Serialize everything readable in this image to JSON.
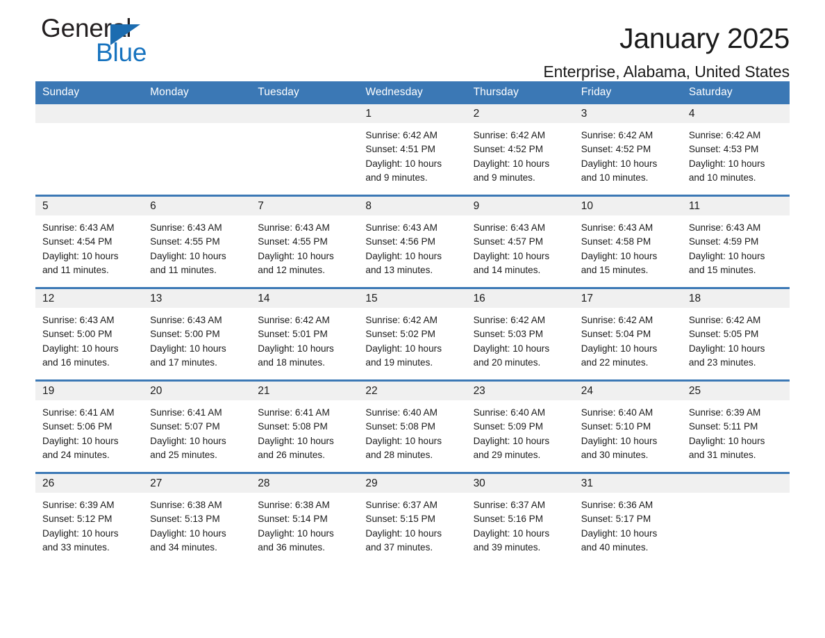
{
  "brand": {
    "word1": "General",
    "word2": "Blue",
    "accent_color": "#1b6cb0"
  },
  "header": {
    "title": "January 2025",
    "location": "Enterprise, Alabama, United States"
  },
  "theme": {
    "header_blue": "#3b78b5",
    "daynum_gray": "#f0f0f0",
    "text": "#1a1a1a"
  },
  "weekdays": [
    "Sunday",
    "Monday",
    "Tuesday",
    "Wednesday",
    "Thursday",
    "Friday",
    "Saturday"
  ],
  "weeks": [
    [
      {
        "day": "",
        "sunrise": "",
        "sunset": "",
        "daylight1": "",
        "daylight2": "",
        "empty": true
      },
      {
        "day": "",
        "sunrise": "",
        "sunset": "",
        "daylight1": "",
        "daylight2": "",
        "empty": true
      },
      {
        "day": "",
        "sunrise": "",
        "sunset": "",
        "daylight1": "",
        "daylight2": "",
        "empty": true
      },
      {
        "day": "1",
        "sunrise": "Sunrise: 6:42 AM",
        "sunset": "Sunset: 4:51 PM",
        "daylight1": "Daylight: 10 hours",
        "daylight2": "and 9 minutes."
      },
      {
        "day": "2",
        "sunrise": "Sunrise: 6:42 AM",
        "sunset": "Sunset: 4:52 PM",
        "daylight1": "Daylight: 10 hours",
        "daylight2": "and 9 minutes."
      },
      {
        "day": "3",
        "sunrise": "Sunrise: 6:42 AM",
        "sunset": "Sunset: 4:52 PM",
        "daylight1": "Daylight: 10 hours",
        "daylight2": "and 10 minutes."
      },
      {
        "day": "4",
        "sunrise": "Sunrise: 6:42 AM",
        "sunset": "Sunset: 4:53 PM",
        "daylight1": "Daylight: 10 hours",
        "daylight2": "and 10 minutes."
      }
    ],
    [
      {
        "day": "5",
        "sunrise": "Sunrise: 6:43 AM",
        "sunset": "Sunset: 4:54 PM",
        "daylight1": "Daylight: 10 hours",
        "daylight2": "and 11 minutes."
      },
      {
        "day": "6",
        "sunrise": "Sunrise: 6:43 AM",
        "sunset": "Sunset: 4:55 PM",
        "daylight1": "Daylight: 10 hours",
        "daylight2": "and 11 minutes."
      },
      {
        "day": "7",
        "sunrise": "Sunrise: 6:43 AM",
        "sunset": "Sunset: 4:55 PM",
        "daylight1": "Daylight: 10 hours",
        "daylight2": "and 12 minutes."
      },
      {
        "day": "8",
        "sunrise": "Sunrise: 6:43 AM",
        "sunset": "Sunset: 4:56 PM",
        "daylight1": "Daylight: 10 hours",
        "daylight2": "and 13 minutes."
      },
      {
        "day": "9",
        "sunrise": "Sunrise: 6:43 AM",
        "sunset": "Sunset: 4:57 PM",
        "daylight1": "Daylight: 10 hours",
        "daylight2": "and 14 minutes."
      },
      {
        "day": "10",
        "sunrise": "Sunrise: 6:43 AM",
        "sunset": "Sunset: 4:58 PM",
        "daylight1": "Daylight: 10 hours",
        "daylight2": "and 15 minutes."
      },
      {
        "day": "11",
        "sunrise": "Sunrise: 6:43 AM",
        "sunset": "Sunset: 4:59 PM",
        "daylight1": "Daylight: 10 hours",
        "daylight2": "and 15 minutes."
      }
    ],
    [
      {
        "day": "12",
        "sunrise": "Sunrise: 6:43 AM",
        "sunset": "Sunset: 5:00 PM",
        "daylight1": "Daylight: 10 hours",
        "daylight2": "and 16 minutes."
      },
      {
        "day": "13",
        "sunrise": "Sunrise: 6:43 AM",
        "sunset": "Sunset: 5:00 PM",
        "daylight1": "Daylight: 10 hours",
        "daylight2": "and 17 minutes."
      },
      {
        "day": "14",
        "sunrise": "Sunrise: 6:42 AM",
        "sunset": "Sunset: 5:01 PM",
        "daylight1": "Daylight: 10 hours",
        "daylight2": "and 18 minutes."
      },
      {
        "day": "15",
        "sunrise": "Sunrise: 6:42 AM",
        "sunset": "Sunset: 5:02 PM",
        "daylight1": "Daylight: 10 hours",
        "daylight2": "and 19 minutes."
      },
      {
        "day": "16",
        "sunrise": "Sunrise: 6:42 AM",
        "sunset": "Sunset: 5:03 PM",
        "daylight1": "Daylight: 10 hours",
        "daylight2": "and 20 minutes."
      },
      {
        "day": "17",
        "sunrise": "Sunrise: 6:42 AM",
        "sunset": "Sunset: 5:04 PM",
        "daylight1": "Daylight: 10 hours",
        "daylight2": "and 22 minutes."
      },
      {
        "day": "18",
        "sunrise": "Sunrise: 6:42 AM",
        "sunset": "Sunset: 5:05 PM",
        "daylight1": "Daylight: 10 hours",
        "daylight2": "and 23 minutes."
      }
    ],
    [
      {
        "day": "19",
        "sunrise": "Sunrise: 6:41 AM",
        "sunset": "Sunset: 5:06 PM",
        "daylight1": "Daylight: 10 hours",
        "daylight2": "and 24 minutes."
      },
      {
        "day": "20",
        "sunrise": "Sunrise: 6:41 AM",
        "sunset": "Sunset: 5:07 PM",
        "daylight1": "Daylight: 10 hours",
        "daylight2": "and 25 minutes."
      },
      {
        "day": "21",
        "sunrise": "Sunrise: 6:41 AM",
        "sunset": "Sunset: 5:08 PM",
        "daylight1": "Daylight: 10 hours",
        "daylight2": "and 26 minutes."
      },
      {
        "day": "22",
        "sunrise": "Sunrise: 6:40 AM",
        "sunset": "Sunset: 5:08 PM",
        "daylight1": "Daylight: 10 hours",
        "daylight2": "and 28 minutes."
      },
      {
        "day": "23",
        "sunrise": "Sunrise: 6:40 AM",
        "sunset": "Sunset: 5:09 PM",
        "daylight1": "Daylight: 10 hours",
        "daylight2": "and 29 minutes."
      },
      {
        "day": "24",
        "sunrise": "Sunrise: 6:40 AM",
        "sunset": "Sunset: 5:10 PM",
        "daylight1": "Daylight: 10 hours",
        "daylight2": "and 30 minutes."
      },
      {
        "day": "25",
        "sunrise": "Sunrise: 6:39 AM",
        "sunset": "Sunset: 5:11 PM",
        "daylight1": "Daylight: 10 hours",
        "daylight2": "and 31 minutes."
      }
    ],
    [
      {
        "day": "26",
        "sunrise": "Sunrise: 6:39 AM",
        "sunset": "Sunset: 5:12 PM",
        "daylight1": "Daylight: 10 hours",
        "daylight2": "and 33 minutes."
      },
      {
        "day": "27",
        "sunrise": "Sunrise: 6:38 AM",
        "sunset": "Sunset: 5:13 PM",
        "daylight1": "Daylight: 10 hours",
        "daylight2": "and 34 minutes."
      },
      {
        "day": "28",
        "sunrise": "Sunrise: 6:38 AM",
        "sunset": "Sunset: 5:14 PM",
        "daylight1": "Daylight: 10 hours",
        "daylight2": "and 36 minutes."
      },
      {
        "day": "29",
        "sunrise": "Sunrise: 6:37 AM",
        "sunset": "Sunset: 5:15 PM",
        "daylight1": "Daylight: 10 hours",
        "daylight2": "and 37 minutes."
      },
      {
        "day": "30",
        "sunrise": "Sunrise: 6:37 AM",
        "sunset": "Sunset: 5:16 PM",
        "daylight1": "Daylight: 10 hours",
        "daylight2": "and 39 minutes."
      },
      {
        "day": "31",
        "sunrise": "Sunrise: 6:36 AM",
        "sunset": "Sunset: 5:17 PM",
        "daylight1": "Daylight: 10 hours",
        "daylight2": "and 40 minutes."
      },
      {
        "day": "",
        "sunrise": "",
        "sunset": "",
        "daylight1": "",
        "daylight2": "",
        "empty": true
      }
    ]
  ]
}
